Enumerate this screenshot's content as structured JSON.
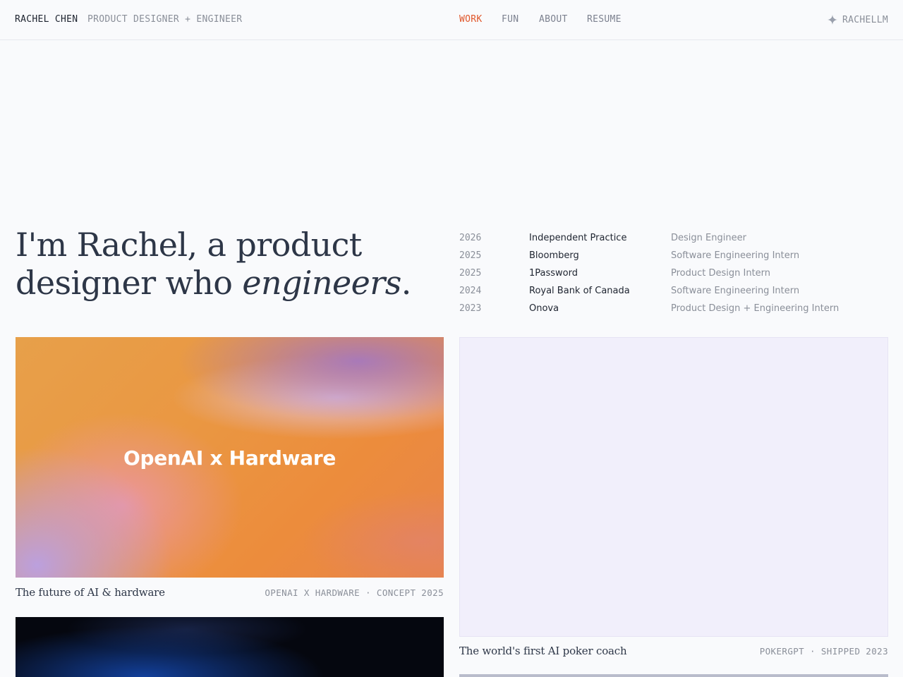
{
  "header": {
    "brand": "RACHEL CHEN",
    "tagline": "PRODUCT DESIGNER + ENGINEER",
    "nav": [
      "WORK",
      "FUN",
      "ABOUT",
      "RESUME"
    ],
    "active_nav": "WORK",
    "llm_label": "RACHELLM",
    "llm_icon": "sparkle-icon"
  },
  "hero": {
    "line1": "I'm Rachel, a product",
    "line2_prefix": "designer who ",
    "line2_italic": "engineers",
    "line2_suffix": "."
  },
  "timeline": [
    {
      "year": "2026",
      "company": "Independent Practice",
      "role": "Design Engineer"
    },
    {
      "year": "2025",
      "company": "Bloomberg",
      "role": "Software Engineering Intern"
    },
    {
      "year": "2025",
      "company": "1Password",
      "role": "Product Design Intern"
    },
    {
      "year": "2024",
      "company": "Royal Bank of Canada",
      "role": "Software Engineering Intern"
    },
    {
      "year": "2023",
      "company": "Onova",
      "role": "Product Design + Engineering Intern"
    }
  ],
  "projects": [
    {
      "image_title": "OpenAI x Hardware",
      "caption": "The future of AI & hardware",
      "meta": "OPENAI X HARDWARE · CONCEPT 2025"
    },
    {
      "caption": "The world's first AI poker coach",
      "meta": "POKERGPT · SHIPPED 2023"
    }
  ],
  "colors": {
    "accent": "#e0572b",
    "background": "#f9fafc",
    "text": "#2d3647",
    "muted": "#8a8f99"
  }
}
